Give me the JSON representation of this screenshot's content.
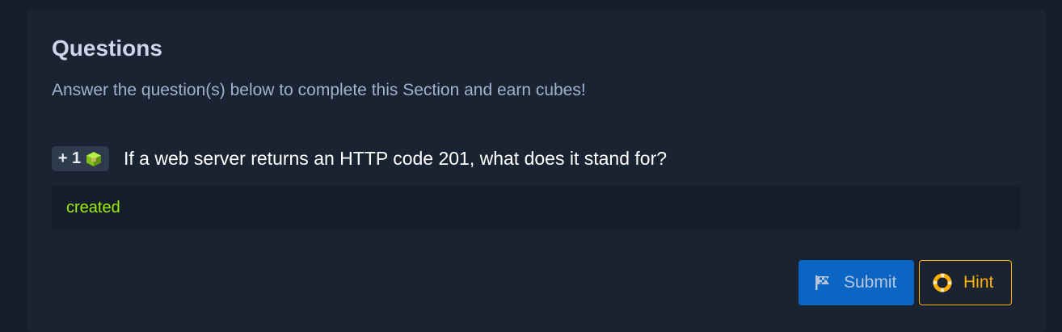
{
  "section": {
    "title": "Questions",
    "subtitle": "Answer the question(s) below to complete this Section and earn cubes!"
  },
  "question": {
    "reward_label": "+ 1",
    "reward_icon": "cube-icon",
    "text": "If a web server returns an HTTP code 201, what does it stand for?",
    "answer_value": "created"
  },
  "actions": {
    "submit_label": "Submit",
    "submit_icon": "flag-icon",
    "hint_label": "Hint",
    "hint_icon": "lifebuoy-icon"
  },
  "colors": {
    "background": "#141d2b",
    "card": "#1a2332",
    "answer_text": "#9fef00",
    "submit_bg": "#0a66c2",
    "hint_accent": "#ffaf00"
  }
}
